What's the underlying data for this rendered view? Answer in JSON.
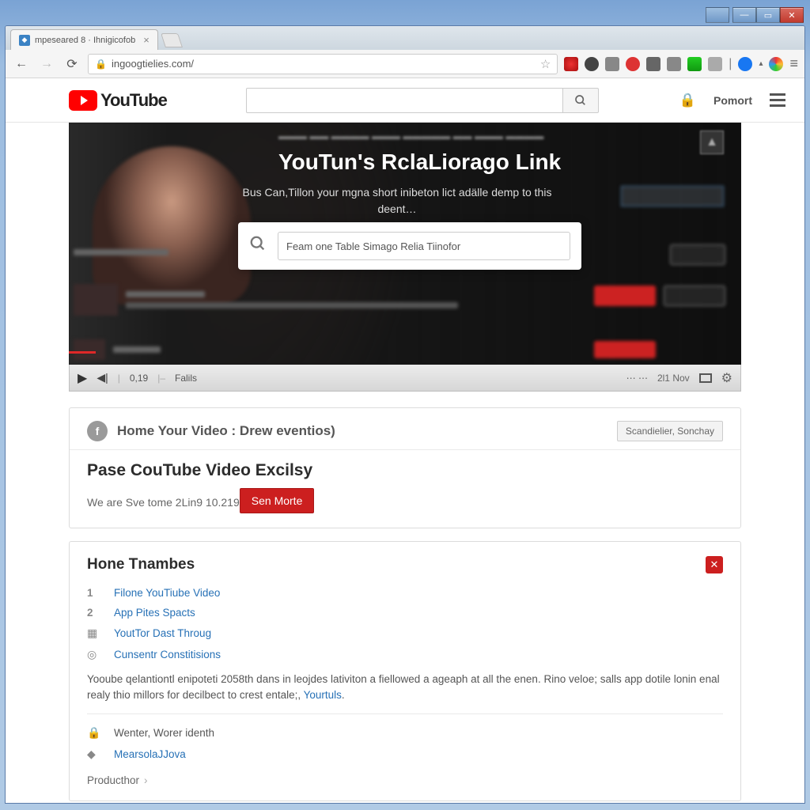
{
  "window": {
    "tab_title": "mpeseared 8 · Ihnigicofob",
    "url": "ingoogtielies.com/"
  },
  "yt_header": {
    "logo_text": "YouTube",
    "search_placeholder": "",
    "username": "Pomort"
  },
  "hero": {
    "title": "YouTun's RclaLiorago Link",
    "subtitle": "Bus Can,Tillon your mgna short inibeton lict adälle demp to this deent…",
    "modal_search_value": "Feam one Table Simago Relia Tiinofor"
  },
  "player": {
    "time": "0,19",
    "label": "Falils",
    "right_text": "2l1 Nov"
  },
  "card1": {
    "head_badge": "f",
    "head_text": "Home Your Video :  Drew eventios)",
    "head_button": "Scandielier, Sonchay",
    "heading": "Pase CouTube Video Excilsy",
    "sub": "We are Sve tome 2Lin9 10.219",
    "cta": "Sen Morte"
  },
  "card2": {
    "title": "Hone Tnambes",
    "items": [
      {
        "num": "1",
        "label": "Filone YouTiube Video"
      },
      {
        "num": "2",
        "label": "App Pites Spacts"
      },
      {
        "icon": "calendar",
        "label": "YoutTor Dast Throug"
      },
      {
        "icon": "box",
        "label": "Cunsentr Constitisions"
      }
    ],
    "desc_prefix": "Yooube qelantiontl enipoteti 2058th dans in leojdes lativiton a fiellowed a ageaph at all the enen. Rino veloe; salls app dotile lonin enal realy thio millors for decilbect to crest entale;, ",
    "desc_link": "Yourtuls",
    "lower_items": [
      {
        "icon": "lock",
        "label": "Wenter,  Worer identh"
      },
      {
        "icon": "diamond",
        "label": "MearsolaJJova"
      }
    ],
    "crumb": "Producthor"
  }
}
